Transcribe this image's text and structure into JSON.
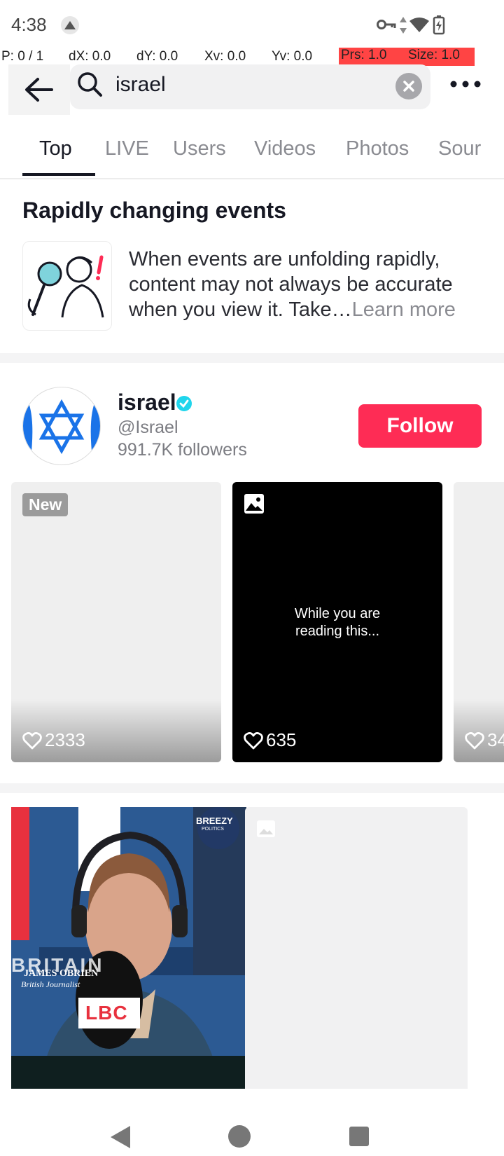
{
  "status_bar": {
    "time": "4:38"
  },
  "pointer_overlay": {
    "p": "P: 0 / 1",
    "dx": "dX: 0.0",
    "dy": "dY: 0.0",
    "xv": "Xv: 0.0",
    "yv": "Yv: 0.0",
    "prs": "Prs: 1.0",
    "size": "Size: 1.0"
  },
  "search": {
    "query": "israel"
  },
  "tabs": [
    "Top",
    "LIVE",
    "Users",
    "Videos",
    "Photos",
    "Sour"
  ],
  "notice": {
    "title": "Rapidly changing events",
    "body": "When events are unfolding rapidly, content may not always be accurate when you view it. Take…",
    "learn_more": "Learn more"
  },
  "user": {
    "name": "israel",
    "handle": "@Israel",
    "followers": "991.7K followers",
    "follow_label": "Follow"
  },
  "thumbnails": [
    {
      "badge": "New",
      "likes": "2333"
    },
    {
      "caption_line1": "While you are",
      "caption_line2": "reading this...",
      "likes": "635"
    },
    {
      "likes": "34"
    }
  ],
  "video_overlay": {
    "name": "JAMES OBRIEN",
    "role": "British Journalist",
    "channel_badge": "BREEZY",
    "channel_badge_sub": "POLITICS",
    "mic_text": "LBC",
    "bg_text": "BRITAIN"
  },
  "colors": {
    "accent": "#fe2c55",
    "verified": "#20d5ec",
    "flag_blue": "#1a73e8"
  }
}
